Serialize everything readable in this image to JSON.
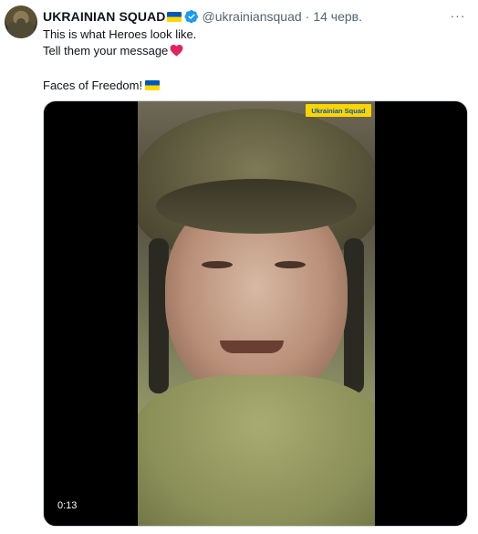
{
  "tweet": {
    "author_name": "UKRAINIAN SQUAD",
    "handle": "@ukrainiansquad",
    "separator": "·",
    "date": "14 черв.",
    "more_label": "···",
    "lines": [
      "This is what Heroes look like.",
      "Tell them your message",
      "Faces of Freedom!"
    ],
    "icons": {
      "name_flag": "ukraine-flag-icon",
      "verified": "verified-badge-icon",
      "heart": "red-heart-icon",
      "text_flag": "ukraine-flag-icon"
    }
  },
  "media": {
    "watermark": "Ukrainian Squad",
    "duration": "0:13"
  },
  "colors": {
    "verified": "#1d9bf0",
    "heart": "#e0245e",
    "flag_blue": "#0057b7",
    "flag_yellow": "#ffd700",
    "secondary_text": "#536471"
  }
}
